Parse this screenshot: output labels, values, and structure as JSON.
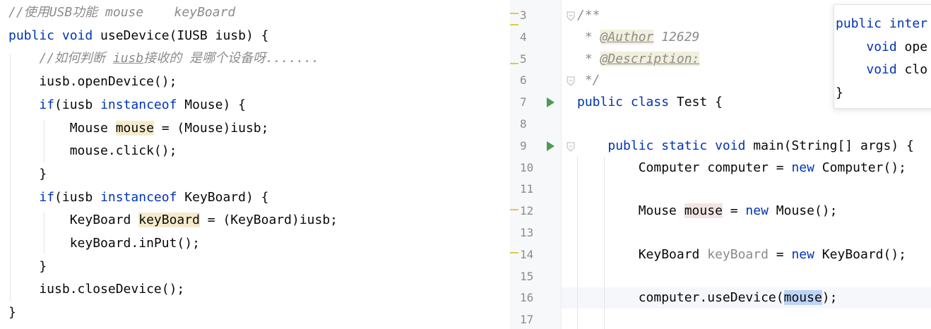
{
  "left_editor": {
    "lines": [
      [
        {
          "t": "//使用USB功能 mouse    keyBoard",
          "c": "cmt"
        }
      ],
      [
        {
          "t": "public void ",
          "c": "kw"
        },
        {
          "t": "useDevice(IUSB iusb) {"
        }
      ],
      [
        {
          "t": "    "
        },
        {
          "t": "//如何判断 ",
          "c": "cmt"
        },
        {
          "t": "iusb",
          "c": "cmt-ul"
        },
        {
          "t": "接收的 是哪个设备呀.......",
          "c": "cmt"
        }
      ],
      [
        {
          "t": "    iusb.openDevice();"
        }
      ],
      [
        {
          "t": "    "
        },
        {
          "t": "if",
          "c": "kw"
        },
        {
          "t": "(iusb "
        },
        {
          "t": "instanceof",
          "c": "kw"
        },
        {
          "t": " Mouse) {"
        }
      ],
      [
        {
          "t": "        Mouse "
        },
        {
          "t": "mouse",
          "c": "hl"
        },
        {
          "t": " = (Mouse)iusb;"
        }
      ],
      [
        {
          "t": "        mouse.click();"
        }
      ],
      [
        {
          "t": "    }"
        }
      ],
      [
        {
          "t": "    "
        },
        {
          "t": "if",
          "c": "kw"
        },
        {
          "t": "(iusb "
        },
        {
          "t": "instanceof",
          "c": "kw"
        },
        {
          "t": " KeyBoard) {"
        }
      ],
      [
        {
          "t": "        KeyBoard "
        },
        {
          "t": "keyBoard",
          "c": "hl"
        },
        {
          "t": " = (KeyBoard)iusb;"
        }
      ],
      [
        {
          "t": "        keyBoard.inPut();"
        }
      ],
      [
        {
          "t": "    }"
        }
      ],
      [
        {
          "t": "    iusb.closeDevice();"
        }
      ],
      [
        {
          "t": "}"
        }
      ]
    ]
  },
  "right_editor": {
    "line_numbers": [
      "3",
      "4",
      "5",
      "6",
      "7",
      "8",
      "9",
      "10",
      "11",
      "12",
      "13",
      "14",
      "15",
      "16",
      "17"
    ],
    "lines": [
      [
        {
          "t": "/**",
          "c": "cmt"
        }
      ],
      [
        {
          "t": " * ",
          "c": "cmt"
        },
        {
          "t": "@Author",
          "c": "tag"
        },
        {
          "t": " 12629",
          "c": "cmt"
        }
      ],
      [
        {
          "t": " * ",
          "c": "cmt"
        },
        {
          "t": "@Description:",
          "c": "tag"
        }
      ],
      [
        {
          "t": " */",
          "c": "cmt"
        }
      ],
      [
        {
          "t": "public class ",
          "c": "kw"
        },
        {
          "t": "Test {"
        }
      ],
      [],
      [
        {
          "t": "    "
        },
        {
          "t": "public static void ",
          "c": "kw"
        },
        {
          "t": "main(String[] args) {"
        }
      ],
      [
        {
          "t": "        Computer computer = "
        },
        {
          "t": "new",
          "c": "kw"
        },
        {
          "t": " Computer();"
        }
      ],
      [],
      [
        {
          "t": "        Mouse "
        },
        {
          "t": "mouse",
          "c": "hl2"
        },
        {
          "t": " = "
        },
        {
          "t": "new",
          "c": "kw"
        },
        {
          "t": " Mouse();"
        }
      ],
      [],
      [
        {
          "t": "        KeyBoard "
        },
        {
          "t": "keyBoard",
          "c": "unused"
        },
        {
          "t": " = "
        },
        {
          "t": "new",
          "c": "kw"
        },
        {
          "t": " KeyBoard();"
        }
      ],
      [],
      [
        {
          "t": "        computer.useDevice("
        },
        {
          "t": "mouse",
          "c": "sel"
        },
        {
          "t": ");"
        }
      ],
      []
    ]
  },
  "popup": {
    "lines": [
      [
        {
          "t": "public ",
          "c": "kw"
        },
        {
          "t": "inter",
          "c": "kw"
        }
      ],
      [
        {
          "t": "    "
        },
        {
          "t": "void ",
          "c": "kw"
        },
        {
          "t": "ope"
        }
      ],
      [
        {
          "t": "    "
        },
        {
          "t": "void ",
          "c": "kw"
        },
        {
          "t": "clo"
        }
      ],
      [
        {
          "t": "}"
        }
      ]
    ]
  },
  "colors": {
    "keyword": "#0033b3",
    "comment": "#8c8c8c",
    "run_icon": "#499c54",
    "marker": "#e2c64a",
    "selection": "#bcd4f6"
  },
  "icons": {
    "run": "run-triangle-icon",
    "fold": "fold-icon"
  }
}
